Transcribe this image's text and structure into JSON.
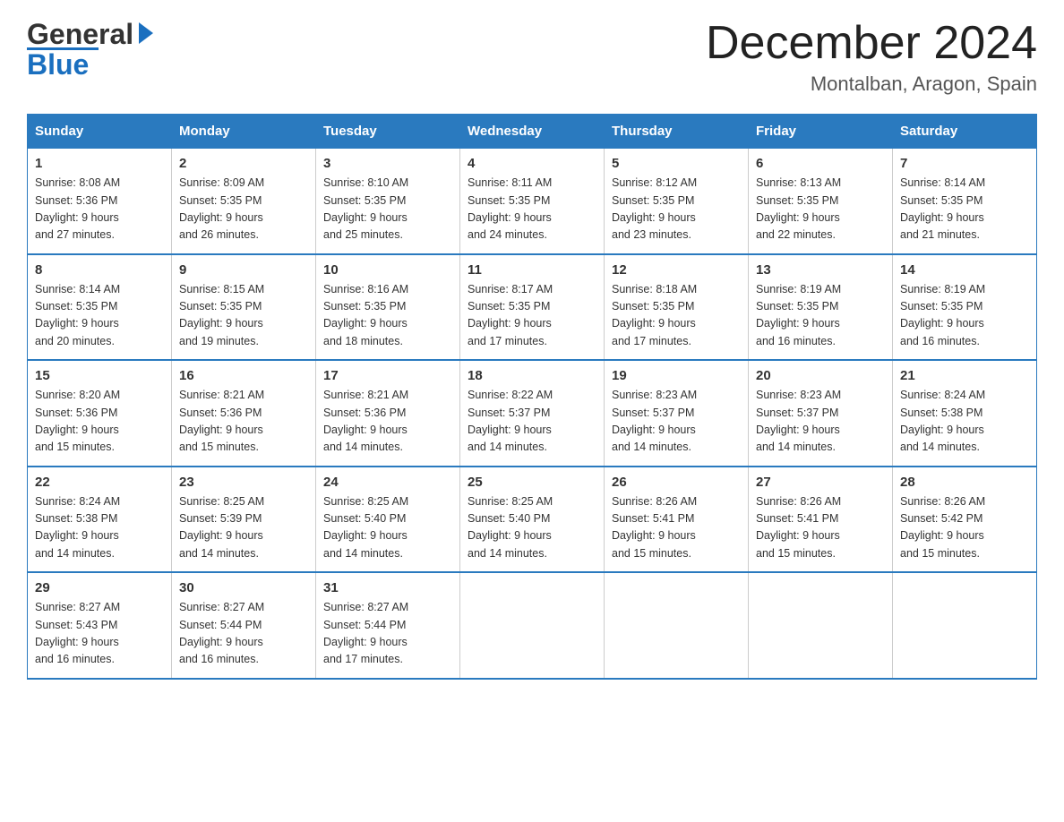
{
  "header": {
    "logo_general": "General",
    "logo_blue": "Blue",
    "month_title": "December 2024",
    "location": "Montalban, Aragon, Spain"
  },
  "days_of_week": [
    "Sunday",
    "Monday",
    "Tuesday",
    "Wednesday",
    "Thursday",
    "Friday",
    "Saturday"
  ],
  "weeks": [
    [
      {
        "day": "1",
        "sunrise": "8:08 AM",
        "sunset": "5:36 PM",
        "daylight": "9 hours and 27 minutes."
      },
      {
        "day": "2",
        "sunrise": "8:09 AM",
        "sunset": "5:35 PM",
        "daylight": "9 hours and 26 minutes."
      },
      {
        "day": "3",
        "sunrise": "8:10 AM",
        "sunset": "5:35 PM",
        "daylight": "9 hours and 25 minutes."
      },
      {
        "day": "4",
        "sunrise": "8:11 AM",
        "sunset": "5:35 PM",
        "daylight": "9 hours and 24 minutes."
      },
      {
        "day": "5",
        "sunrise": "8:12 AM",
        "sunset": "5:35 PM",
        "daylight": "9 hours and 23 minutes."
      },
      {
        "day": "6",
        "sunrise": "8:13 AM",
        "sunset": "5:35 PM",
        "daylight": "9 hours and 22 minutes."
      },
      {
        "day": "7",
        "sunrise": "8:14 AM",
        "sunset": "5:35 PM",
        "daylight": "9 hours and 21 minutes."
      }
    ],
    [
      {
        "day": "8",
        "sunrise": "8:14 AM",
        "sunset": "5:35 PM",
        "daylight": "9 hours and 20 minutes."
      },
      {
        "day": "9",
        "sunrise": "8:15 AM",
        "sunset": "5:35 PM",
        "daylight": "9 hours and 19 minutes."
      },
      {
        "day": "10",
        "sunrise": "8:16 AM",
        "sunset": "5:35 PM",
        "daylight": "9 hours and 18 minutes."
      },
      {
        "day": "11",
        "sunrise": "8:17 AM",
        "sunset": "5:35 PM",
        "daylight": "9 hours and 17 minutes."
      },
      {
        "day": "12",
        "sunrise": "8:18 AM",
        "sunset": "5:35 PM",
        "daylight": "9 hours and 17 minutes."
      },
      {
        "day": "13",
        "sunrise": "8:19 AM",
        "sunset": "5:35 PM",
        "daylight": "9 hours and 16 minutes."
      },
      {
        "day": "14",
        "sunrise": "8:19 AM",
        "sunset": "5:35 PM",
        "daylight": "9 hours and 16 minutes."
      }
    ],
    [
      {
        "day": "15",
        "sunrise": "8:20 AM",
        "sunset": "5:36 PM",
        "daylight": "9 hours and 15 minutes."
      },
      {
        "day": "16",
        "sunrise": "8:21 AM",
        "sunset": "5:36 PM",
        "daylight": "9 hours and 15 minutes."
      },
      {
        "day": "17",
        "sunrise": "8:21 AM",
        "sunset": "5:36 PM",
        "daylight": "9 hours and 14 minutes."
      },
      {
        "day": "18",
        "sunrise": "8:22 AM",
        "sunset": "5:37 PM",
        "daylight": "9 hours and 14 minutes."
      },
      {
        "day": "19",
        "sunrise": "8:23 AM",
        "sunset": "5:37 PM",
        "daylight": "9 hours and 14 minutes."
      },
      {
        "day": "20",
        "sunrise": "8:23 AM",
        "sunset": "5:37 PM",
        "daylight": "9 hours and 14 minutes."
      },
      {
        "day": "21",
        "sunrise": "8:24 AM",
        "sunset": "5:38 PM",
        "daylight": "9 hours and 14 minutes."
      }
    ],
    [
      {
        "day": "22",
        "sunrise": "8:24 AM",
        "sunset": "5:38 PM",
        "daylight": "9 hours and 14 minutes."
      },
      {
        "day": "23",
        "sunrise": "8:25 AM",
        "sunset": "5:39 PM",
        "daylight": "9 hours and 14 minutes."
      },
      {
        "day": "24",
        "sunrise": "8:25 AM",
        "sunset": "5:40 PM",
        "daylight": "9 hours and 14 minutes."
      },
      {
        "day": "25",
        "sunrise": "8:25 AM",
        "sunset": "5:40 PM",
        "daylight": "9 hours and 14 minutes."
      },
      {
        "day": "26",
        "sunrise": "8:26 AM",
        "sunset": "5:41 PM",
        "daylight": "9 hours and 15 minutes."
      },
      {
        "day": "27",
        "sunrise": "8:26 AM",
        "sunset": "5:41 PM",
        "daylight": "9 hours and 15 minutes."
      },
      {
        "day": "28",
        "sunrise": "8:26 AM",
        "sunset": "5:42 PM",
        "daylight": "9 hours and 15 minutes."
      }
    ],
    [
      {
        "day": "29",
        "sunrise": "8:27 AM",
        "sunset": "5:43 PM",
        "daylight": "9 hours and 16 minutes."
      },
      {
        "day": "30",
        "sunrise": "8:27 AM",
        "sunset": "5:44 PM",
        "daylight": "9 hours and 16 minutes."
      },
      {
        "day": "31",
        "sunrise": "8:27 AM",
        "sunset": "5:44 PM",
        "daylight": "9 hours and 17 minutes."
      },
      null,
      null,
      null,
      null
    ]
  ],
  "labels": {
    "sunrise": "Sunrise:",
    "sunset": "Sunset:",
    "daylight": "Daylight:"
  }
}
